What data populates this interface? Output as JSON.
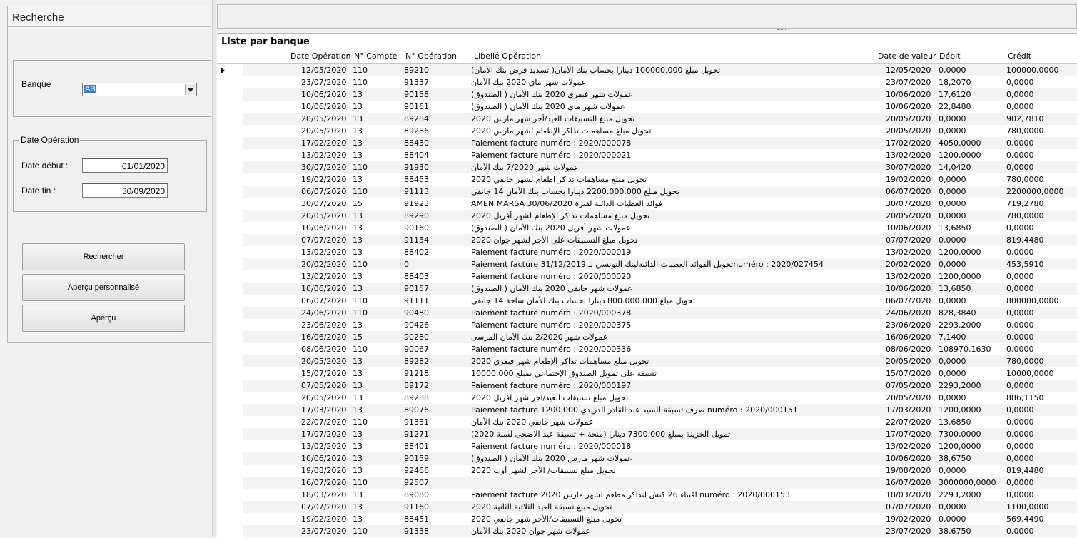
{
  "left": {
    "title": "Recherche",
    "banque_label": "Banque",
    "banque_value": "AB",
    "date_group_label": "Date Opération",
    "date_debut_label": "Date début :",
    "date_debut_value": "01/01/2020",
    "date_fin_label": "Date fin :",
    "date_fin_value": "30/09/2020",
    "btn_rechercher": "Rechercher",
    "btn_apercu_perso": "Aperçu personnalisé",
    "btn_apercu": "Aperçu"
  },
  "grid": {
    "title": "Liste par banque",
    "headers": [
      "Date Opération",
      "N° Compte",
      "N° Opération",
      "Libellé Opération",
      "Date de valeur",
      "Débit",
      "Crédit"
    ],
    "rows": [
      [
        "12/05/2020",
        "110",
        "89210",
        "(تحويل مبلغ 100000.000 دينارا بحساب بنك الأمان( تسديد قرض بنك الأمان",
        "12/05/2020",
        "0,0000",
        "100000,0000"
      ],
      [
        "23/07/2020",
        "110",
        "91337",
        "عمولات شهر ماي 2020 بنك الأمان",
        "23/07/2020",
        "18,2070",
        "0,0000"
      ],
      [
        "10/06/2020",
        "13",
        "90158",
        "(عمولات شهر فيفري 2020 بنك الأمان ( الصندوق",
        "10/06/2020",
        "17,6120",
        "0,0000"
      ],
      [
        "10/06/2020",
        "13",
        "90161",
        "(عمولات شهر ماي 2020 بنك الأمان ( الصندوق",
        "10/06/2020",
        "22,8480",
        "0,0000"
      ],
      [
        "20/05/2020",
        "13",
        "89284",
        "تحويل مبلغ التسبيقات العيد/أجر شهر مارس 2020",
        "20/05/2020",
        "0,0000",
        "902,7810"
      ],
      [
        "20/05/2020",
        "13",
        "89286",
        "تحويل مبلغ مساهمات تذاكر الإطعام لشهر مارس 2020",
        "20/05/2020",
        "0,0000",
        "780,0000"
      ],
      [
        "17/02/2020",
        "13",
        "88430",
        "Paiement facture numéro : 2020/000078",
        "17/02/2020",
        "4050,0000",
        "0,0000"
      ],
      [
        "13/02/2020",
        "13",
        "88404",
        "Paiement facture numéro : 2020/000021",
        "13/02/2020",
        "1200,0000",
        "0,0000"
      ],
      [
        "30/07/2020",
        "110",
        "91930",
        "عمولات شهر 7/2020 بنك الأمان",
        "30/07/2020",
        "14,0420",
        "0,0000"
      ],
      [
        "19/02/2020",
        "13",
        "88453",
        "تحويل مبلغ مساهمات تذاكر اطعام لشهر جانفي 2020",
        "19/02/2020",
        "0,0000",
        "780,0000"
      ],
      [
        "06/07/2020",
        "110",
        "91113",
        "تحويل مبلغ 2200.000.000 دينارا بحساب بنك الأمان 14 جانفي",
        "06/07/2020",
        "0,0000",
        "2200000,0000"
      ],
      [
        "30/07/2020",
        "15",
        "91923",
        "AMEN MARSA 30/06/2020 فوائد العطيات الدائنة لفترة",
        "30/07/2020",
        "0,0000",
        "719,2780"
      ],
      [
        "20/05/2020",
        "13",
        "89290",
        "تحويل مبلغ مساهمات تذاكر الإطعام لشهر أفريل 2020",
        "20/05/2020",
        "0,0000",
        "780,0000"
      ],
      [
        "10/06/2020",
        "13",
        "90160",
        "(عمولات شهر أفريل 2020 بنك الأمان ( الصندوق",
        "10/06/2020",
        "13,6850",
        "0,0000"
      ],
      [
        "07/07/2020",
        "13",
        "91154",
        "تحويل مبلغ التسبيقات على الأجر لشهر جوان 2020",
        "07/07/2020",
        "0,0000",
        "819,4480"
      ],
      [
        "13/02/2020",
        "13",
        "88402",
        "Paiement facture numéro : 2020/000019",
        "13/02/2020",
        "1200,0000",
        "0,0000"
      ],
      [
        "20/02/2020",
        "110",
        "0",
        "Paiement facture 31/12/2019 تحويل الفوائد العطيات الدائنةلبنك التونسي لـnuméro : 2020/027454",
        "20/02/2020",
        "0,0000",
        "453,5910"
      ],
      [
        "13/02/2020",
        "13",
        "88403",
        "Paiement facture numéro : 2020/000020",
        "13/02/2020",
        "1200,0000",
        "0,0000"
      ],
      [
        "10/06/2020",
        "13",
        "90157",
        "(عمولات شهر جانفي 2020 بنك الأمان ( الصندوق",
        "10/06/2020",
        "13,6850",
        "0,0000"
      ],
      [
        "06/07/2020",
        "110",
        "91111",
        "تحويل مبلغ 800.000.000 دينارا لحساب بنك الأمان ساحة 14 جانفي",
        "06/07/2020",
        "0,0000",
        "800000,0000"
      ],
      [
        "24/06/2020",
        "110",
        "90480",
        "Paiement facture numéro : 2020/000378",
        "24/06/2020",
        "828,3840",
        "0,0000"
      ],
      [
        "23/06/2020",
        "13",
        "90426",
        "Paiement facture numéro : 2020/000375",
        "23/06/2020",
        "2293,2000",
        "0,0000"
      ],
      [
        "16/06/2020",
        "15",
        "90280",
        "عمولات شهر 2/2020 بنك الأمان  المرسى",
        "16/06/2020",
        "7,1400",
        "0,0000"
      ],
      [
        "08/06/2020",
        "110",
        "90067",
        "Paiement facture numéro : 2020/000336",
        "08/06/2020",
        "108970,1630",
        "0,0000"
      ],
      [
        "20/05/2020",
        "13",
        "89282",
        "تحويل مبلغ مساهمات تذاكر الإطعام شهر فيفري 2020",
        "20/05/2020",
        "0,0000",
        "780,0000"
      ],
      [
        "15/07/2020",
        "13",
        "91218",
        "تسبقة على تمويل الصندوق الإجتماعي بمبلغ 10000.000",
        "15/07/2020",
        "0,0000",
        "10000,0000"
      ],
      [
        "07/05/2020",
        "13",
        "89172",
        "Paiement facture numéro : 2020/000197",
        "07/05/2020",
        "2293,2000",
        "0,0000"
      ],
      [
        "20/05/2020",
        "13",
        "89288",
        "تحويل مبلغ تسبيقات العيد/اجر شهر افريل 2020",
        "20/05/2020",
        "0,0000",
        "886,1150"
      ],
      [
        "17/03/2020",
        "13",
        "89076",
        "Paiement facture 1200.000 صرف تسبقة للسيد عبد القادر الدريدي numéro : 2020/000151",
        "17/03/2020",
        "1200,0000",
        "0,0000"
      ],
      [
        "22/07/2020",
        "110",
        "91331",
        "عمولات شهر جانفي 2020 بنك الأمان",
        "22/07/2020",
        "13,6850",
        "0,0000"
      ],
      [
        "17/07/2020",
        "13",
        "91271",
        "(تمويل الخزينة بمبلغ 7300.000 دينارا (منحة + تسبقة عيد الاضحى لسنة 2020",
        "17/07/2020",
        "7300,0000",
        "0,0000"
      ],
      [
        "13/02/2020",
        "13",
        "88401",
        "Paiement facture numéro : 2020/000018",
        "13/02/2020",
        "1200,0000",
        "0,0000"
      ],
      [
        "10/06/2020",
        "13",
        "90159",
        "(عمولات شهر مارس 2020 بنك الأمان ( الصندوق",
        "10/06/2020",
        "38,6750",
        "0,0000"
      ],
      [
        "19/08/2020",
        "13",
        "92466",
        "تحويل مبلغ تسبيقات/ الأجر لشهر أوت 2020",
        "19/08/2020",
        "0,0000",
        "819,4480"
      ],
      [
        "16/07/2020",
        "110",
        "92507",
        "",
        "16/07/2020",
        "3000000,0000",
        "0,0000"
      ],
      [
        "18/03/2020",
        "13",
        "89080",
        "Paiement facture 2020 اقتناء 26 كنش لتذاكر مطعم لشهر مارس numéro : 2020/000153",
        "18/03/2020",
        "2293,2000",
        "0,0000"
      ],
      [
        "07/07/2020",
        "13",
        "91160",
        "تحويل مبلغ تسبقة العيد الثلاثية الثانية 2020",
        "07/07/2020",
        "0,0000",
        "1100,0000"
      ],
      [
        "19/02/2020",
        "13",
        "88451",
        "تحويل مبلغ التسبيقات/الأجر شهر جانفي 2020",
        "19/02/2020",
        "0,0000",
        "569,4490"
      ],
      [
        "23/07/2020",
        "110",
        "91338",
        "عمولات شهر جوان 2020 بنك الأمان",
        "23/07/2020",
        "38,6750",
        "0,0000"
      ]
    ]
  }
}
